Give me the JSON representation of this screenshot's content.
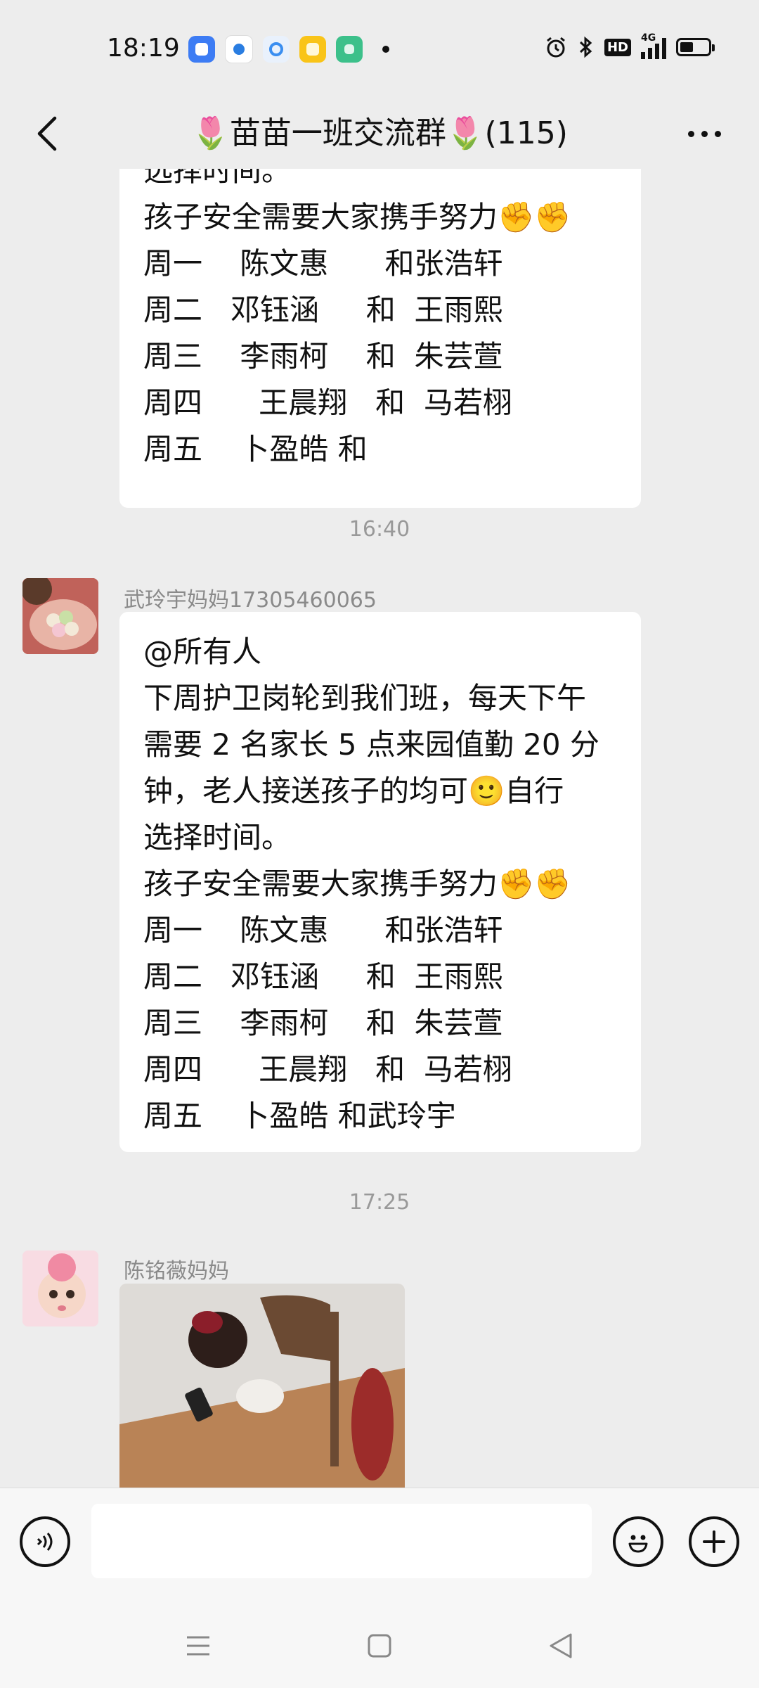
{
  "status_bar": {
    "time": "18:19",
    "network": "4G",
    "hd_label": "HD",
    "icons": [
      "alarm-icon",
      "bluetooth-icon",
      "signal-icon",
      "battery-icon"
    ]
  },
  "header": {
    "title": "🌷苗苗一班交流群🌷(115)",
    "back_icon": "chevron-left-icon",
    "more_icon": "more-icon"
  },
  "messages": {
    "first_partial": {
      "lines": [
        "选择时间。",
        "孩子安全需要大家携手努力✊✊",
        "周一    陈文惠      和张浩轩",
        "周二   邓钰涵     和  王雨熙",
        "周三    李雨柯    和  朱芸萱",
        "周四      王晨翔   和  马若栩",
        "周五    卜盈皓 和"
      ]
    },
    "timestamp_1": "16:40",
    "second": {
      "sender": "武玲宇妈妈17305460065",
      "lines": [
        "@所有人",
        "下周护卫岗轮到我们班，每天下午",
        "需要 2 名家长 5 点来园值勤 20 分",
        "钟，老人接送孩子的均可🙂自行",
        "选择时间。",
        "孩子安全需要大家携手努力✊✊",
        "周一    陈文惠      和张浩轩",
        "周二   邓钰涵     和  王雨熙",
        "周三    李雨柯    和  朱芸萱",
        "周四      王晨翔   和  马若栩",
        "周五    卜盈皓 和武玲宇"
      ]
    },
    "timestamp_2": "17:25",
    "third": {
      "sender": "陈铭薇妈妈"
    }
  },
  "input_bar": {
    "value": "",
    "voice_icon": "voice-icon",
    "emoji_icon": "emoji-icon",
    "add_icon": "plus-icon"
  },
  "nav_bar": {
    "icons": [
      "menu-icon",
      "home-icon",
      "back-icon"
    ]
  },
  "colors": {
    "background": "#ededed",
    "bubble": "#ffffff",
    "timestamp": "#999999",
    "sender": "#8a8a8a"
  }
}
